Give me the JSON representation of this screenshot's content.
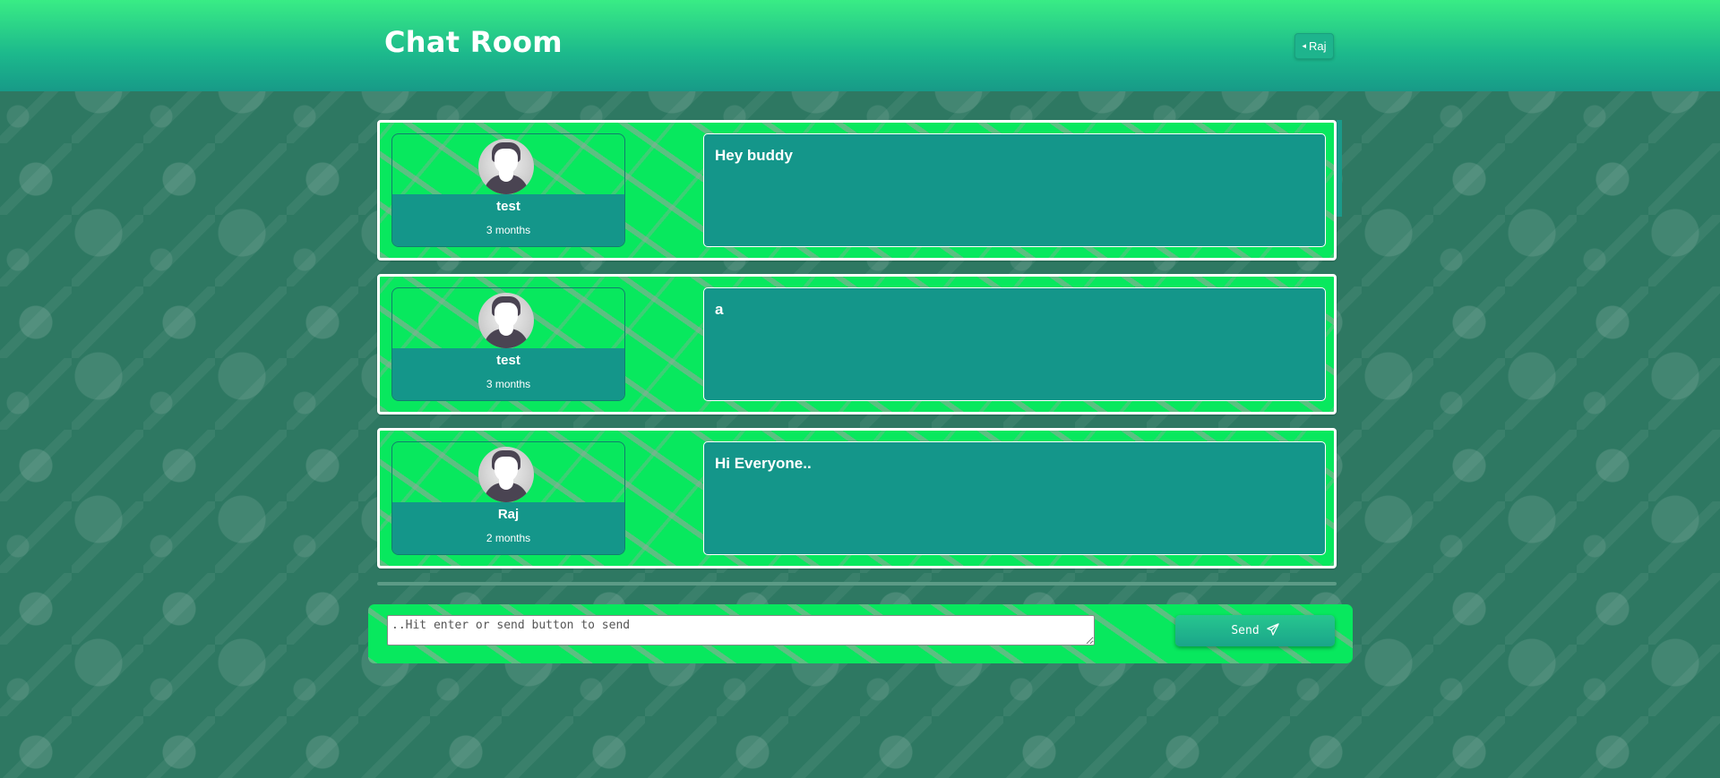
{
  "header": {
    "title": "Chat Room",
    "user_button_label": "Raj"
  },
  "messages": [
    {
      "author": "test",
      "time": "3 months",
      "text": "Hey buddy"
    },
    {
      "author": "test",
      "time": "3 months",
      "text": "a"
    },
    {
      "author": "Raj",
      "time": "2 months",
      "text": "Hi Everyone.."
    }
  ],
  "composer": {
    "placeholder": "..Hit enter or send button to send",
    "send_label": "Send"
  },
  "colors": {
    "header_top": "#39ec85",
    "header_bottom": "#179a88",
    "card_green": "#08e85e",
    "teal": "#14968a"
  },
  "icons": {
    "user_button": "caret-left-icon",
    "send_button": "paper-plane-icon",
    "avatar": "user-avatar-icon"
  }
}
